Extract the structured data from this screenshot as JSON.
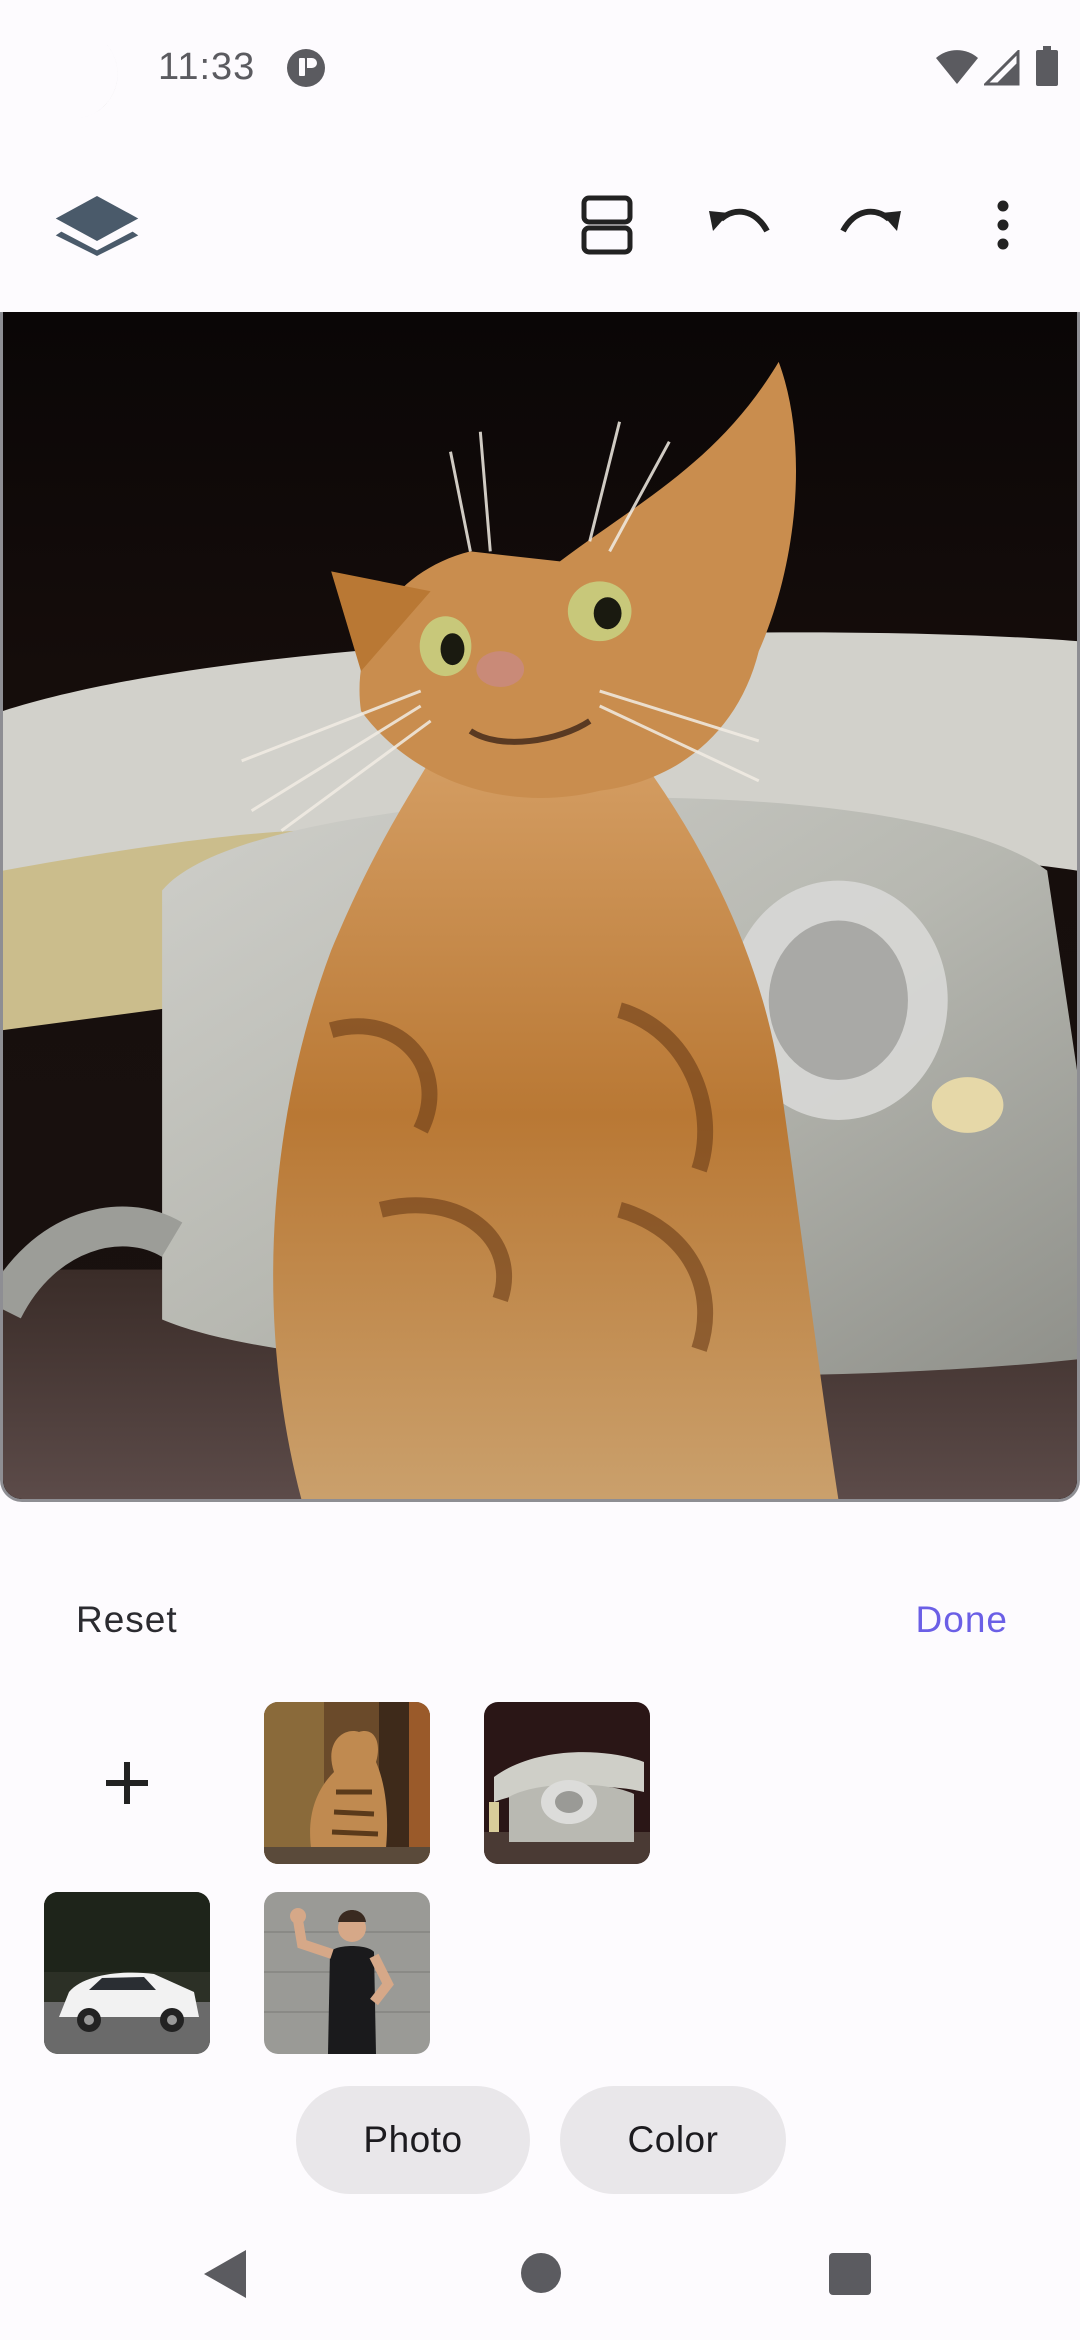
{
  "status_bar": {
    "time": "11:33",
    "icons": [
      "moon-icon",
      "notification-icon",
      "wifi-icon",
      "signal-icon",
      "battery-icon"
    ]
  },
  "toolbar": {
    "icons": [
      "layers-icon",
      "split-view-icon",
      "undo-icon",
      "redo-icon",
      "more-vert-icon"
    ]
  },
  "actions": {
    "reset_label": "Reset",
    "done_label": "Done"
  },
  "thumbnails": [
    {
      "subject": "cat"
    },
    {
      "subject": "rotary-telephone"
    },
    {
      "subject": "white-car"
    },
    {
      "subject": "woman-flexing"
    }
  ],
  "chips": {
    "photo_label": "Photo",
    "color_label": "Color"
  },
  "colors": {
    "accent": "#6b5fe6",
    "chip_bg": "#e9e7ea",
    "icon": "#4a5a6a"
  }
}
